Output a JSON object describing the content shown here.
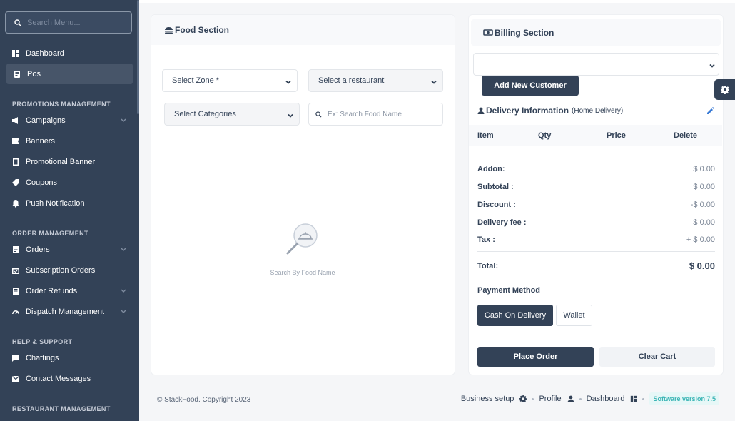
{
  "sidebar": {
    "search_placeholder": "Search Menu...",
    "items": [
      {
        "label": "Dashboard",
        "icon": "dashboard-icon"
      },
      {
        "label": "Pos",
        "icon": "pos-icon",
        "active": true
      }
    ],
    "promotions": {
      "heading": "PROMOTIONS MANAGEMENT",
      "items": [
        {
          "label": "Campaigns",
          "icon": "campaign-icon",
          "has_submenu": true
        },
        {
          "label": "Banners",
          "icon": "banner-icon"
        },
        {
          "label": "Promotional Banner",
          "icon": "promotional-banner-icon"
        },
        {
          "label": "Coupons",
          "icon": "coupon-icon"
        },
        {
          "label": "Push Notification",
          "icon": "notification-icon"
        }
      ]
    },
    "orders": {
      "heading": "ORDER MANAGEMENT",
      "items": [
        {
          "label": "Orders",
          "icon": "orders-icon",
          "has_submenu": true
        },
        {
          "label": "Subscription Orders",
          "icon": "subscription-icon"
        },
        {
          "label": "Order Refunds",
          "icon": "refund-icon",
          "has_submenu": true
        },
        {
          "label": "Dispatch Management",
          "icon": "dispatch-icon",
          "has_submenu": true
        }
      ]
    },
    "help": {
      "heading": "HELP & SUPPORT",
      "items": [
        {
          "label": "Chattings",
          "icon": "chat-icon"
        },
        {
          "label": "Contact Messages",
          "icon": "mail-icon"
        }
      ]
    },
    "restaurant_heading": "RESTAURANT MANAGEMENT"
  },
  "food_section": {
    "title": "Food Section",
    "zone_select": "Select Zone *",
    "restaurant_select": "Select a restaurant",
    "category_select": "Select Categories",
    "search_placeholder": "Ex: Search Food Name",
    "empty_text": "Search By Food Name"
  },
  "billing_section": {
    "title": "Billing Section",
    "add_customer": "Add New Customer",
    "delivery_title": "Delivery Information",
    "delivery_sub": "(Home Delivery)",
    "cart_columns": [
      "Item",
      "Qty",
      "Price",
      "Delete"
    ],
    "summary": [
      {
        "label": "Addon:",
        "value": "$ 0.00"
      },
      {
        "label": "Subtotal :",
        "value": "$ 0.00"
      },
      {
        "label": "Discount :",
        "value": "-$ 0.00"
      },
      {
        "label": "Delivery fee :",
        "value": "$ 0.00"
      },
      {
        "label": "Tax :",
        "value": "+ $ 0.00"
      }
    ],
    "total_label": "Total:",
    "total_value": "$ 0.00",
    "payment_title": "Payment Method",
    "payment_cod": "Cash On Delivery",
    "payment_wallet": "Wallet",
    "place_order": "Place Order",
    "clear_cart": "Clear Cart"
  },
  "footer": {
    "copyright": "© StackFood. Copyright 2023",
    "business_setup": "Business setup",
    "profile": "Profile",
    "dashboard": "Dashboard",
    "version": "Software version 7.5"
  },
  "colors": {
    "sidebar_bg": "#334257",
    "primary": "#334257",
    "version_text": "#3bb5b5"
  }
}
